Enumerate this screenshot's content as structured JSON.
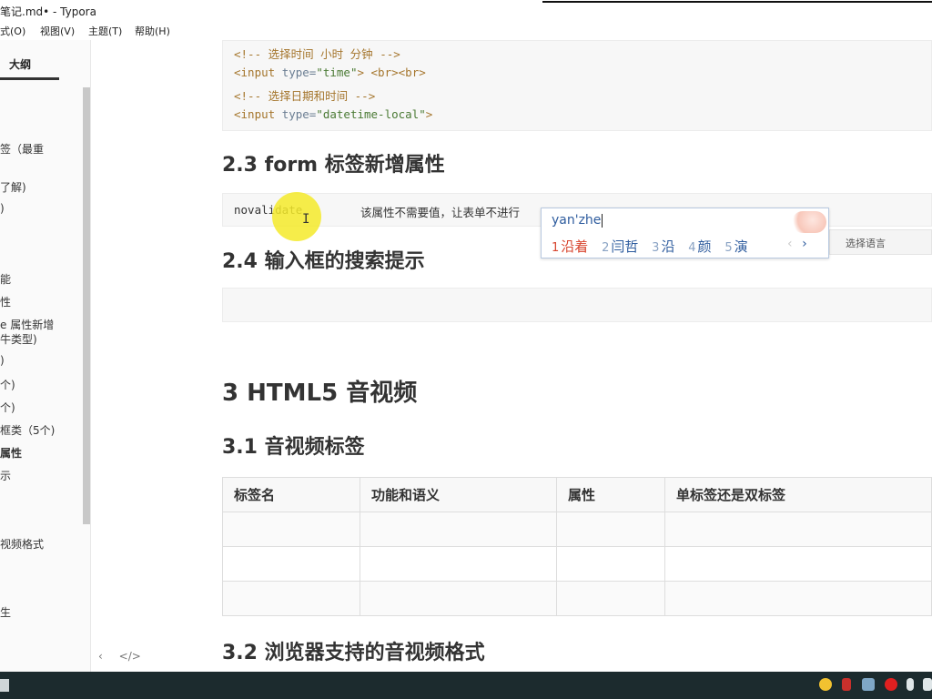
{
  "window": {
    "title": "笔记.md• - Typora"
  },
  "menu": {
    "items": [
      "式(O)",
      "视图(V)",
      "主题(T)",
      "帮助(H)"
    ]
  },
  "sidebar": {
    "tab_label": "大纲",
    "items": [
      {
        "label": "签（最重",
        "bold": false
      },
      {
        "label": "了解)",
        "bold": false
      },
      {
        "label": ")",
        "bold": false
      },
      {
        "label": "能",
        "bold": false
      },
      {
        "label": "性",
        "bold": false
      },
      {
        "label": "e 属性新增",
        "bold": false
      },
      {
        "label": "牛类型)",
        "bold": false
      },
      {
        "label": ")",
        "bold": false
      },
      {
        "label": "个)",
        "bold": false
      },
      {
        "label": "个)",
        "bold": false
      },
      {
        "label": "框类（5个)",
        "bold": false
      },
      {
        "label": "属性",
        "bold": true
      },
      {
        "label": "示",
        "bold": false
      },
      {
        "label": "视频格式",
        "bold": false
      },
      {
        "label": "生",
        "bold": false
      }
    ],
    "footer_icons": [
      "chevron-left-icon",
      "source-code-icon"
    ],
    "footer_glyphs": [
      "‹",
      "</>"
    ]
  },
  "editor": {
    "code_lines": [
      {
        "type": "comment",
        "text": "<!-- 选择时间 小时 分钟 -->"
      },
      {
        "type": "code",
        "tag_open": "<input ",
        "attr": "type=",
        "str": "\"time\"",
        "rest": "> <br><br>"
      },
      {
        "type": "comment",
        "text": "<!-- 选择日期和时间 -->"
      },
      {
        "type": "code",
        "tag_open": "<input ",
        "attr": "type=",
        "str": "\"datetime-local\"",
        "rest": ">"
      }
    ],
    "h_2_3": "2.3 form 标签新增属性",
    "novalidate_code": "novalidate",
    "novalidate_desc": "该属性不需要值，让表单不进行",
    "h_2_4": "2.4 输入框的搜索提示",
    "h_3": "3 HTML5 音视频",
    "h_3_1": "3.1 音视频标签",
    "table": {
      "headers": [
        "标签名",
        "功能和语义",
        "属性",
        "单标签还是双标签"
      ],
      "rows": [
        [
          "",
          "",
          "",
          ""
        ],
        [
          "",
          "",
          "",
          ""
        ],
        [
          "",
          "",
          "",
          ""
        ]
      ]
    },
    "h_3_2": "3.2 浏览器支持的音视频格式"
  },
  "ime": {
    "input": "yan'zhe",
    "candidates": [
      {
        "n": "1",
        "text": "沿着"
      },
      {
        "n": "2",
        "text": "闫哲"
      },
      {
        "n": "3",
        "text": "沿"
      },
      {
        "n": "4",
        "text": "颜"
      },
      {
        "n": "5",
        "text": "演"
      }
    ],
    "prev": "‹",
    "next": "›",
    "lang_label": "选择语言"
  },
  "colors": {
    "cursor_highlight": "#f5ea2a",
    "taskbar": "#1c2b2e",
    "ime_first": "#d8452e",
    "ime_other": "#2e5c9e"
  }
}
